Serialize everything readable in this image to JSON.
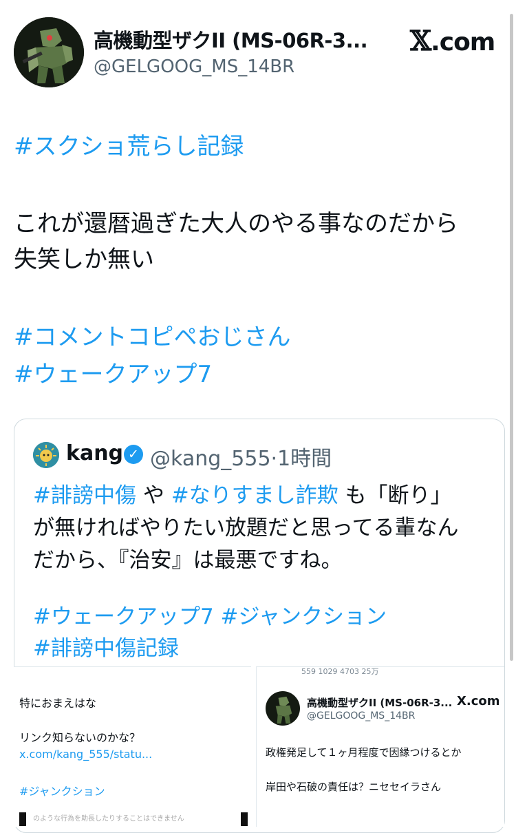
{
  "header": {
    "display_name": "高機動型ザクII (MS-06R-3...",
    "handle": "@GELGOOG_MS_14BR",
    "site": "X.com",
    "avatar_icon": "mobile-suit-avatar-icon"
  },
  "tweet": {
    "hashtag1": "#スクショ荒らし記録",
    "line1": "これが還暦過ぎた大人のやる事なのだから",
    "line2": "失笑しか無い",
    "hashtag2": "#コメントコピペおじさん",
    "hashtag3": "#ウェークアップ7"
  },
  "quote": {
    "name": "kang",
    "verified_icon": "verified-badge-icon",
    "handle_time": "@kang_555·1時間",
    "tag_a": "#誹謗中傷",
    "text_a": " や ",
    "tag_b": "#なりすまし詐欺",
    "text_b": " も「断り」",
    "line2": "が無ければやりたい放題だと思ってる輩なん",
    "line3": "だから、『治安』は最悪ですね。",
    "tags_line": "#ウェークアップ7 #ジャンクション",
    "tag_last": "#誹謗中傷記録"
  },
  "screenshot_left": {
    "line1": "特におまえはな",
    "line2": "リンク知らないのかな？",
    "link": "x.com/kang_555/statu...",
    "tag": "#ジャンクション",
    "cut": "のような行為を助長したりすることはできません"
  },
  "screenshot_right": {
    "stats": "559   1029   4703   25万",
    "name": "高機動型ザクII (MS-06R-3...",
    "site": "X.com",
    "handle": "@GELGOOG_MS_14BR",
    "line1": "政権発足して１ヶ月程度で因縁つけるとか",
    "line2": "岸田や石破の責任は？ニセセイラさん"
  },
  "colors": {
    "link": "#1d9bf0",
    "text": "#0f1419",
    "muted": "#536471"
  }
}
